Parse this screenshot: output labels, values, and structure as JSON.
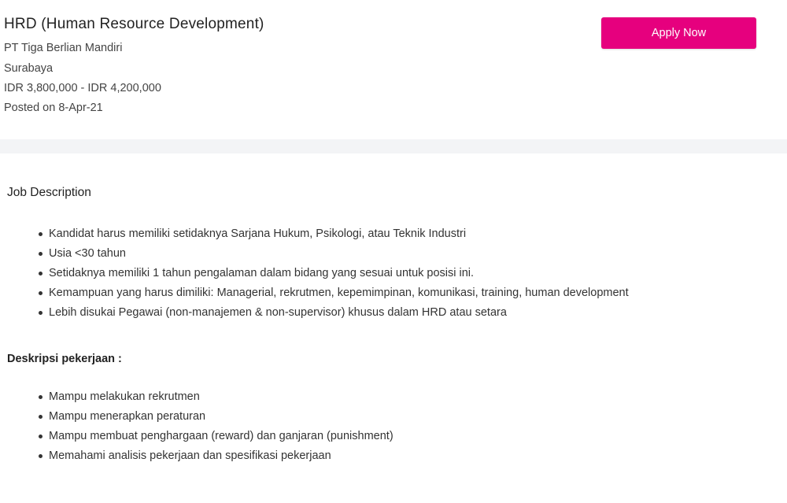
{
  "job": {
    "title": "HRD (Human Resource Development)",
    "company": "PT Tiga Berlian Mandiri",
    "location": "Surabaya",
    "salary": "IDR 3,800,000 - IDR 4,200,000",
    "posted": "Posted on 8-Apr-21"
  },
  "actions": {
    "apply_label": "Apply Now"
  },
  "description": {
    "heading": "Job Description",
    "requirements": [
      "Kandidat harus memiliki setidaknya Sarjana Hukum, Psikologi, atau Teknik Industri",
      "Usia <30 tahun",
      "Setidaknya memiliki 1 tahun pengalaman dalam bidang yang sesuai untuk posisi ini.",
      "Kemampuan yang harus dimiliki: Managerial, rekrutmen, kepemimpinan, komunikasi, training, human development",
      "Lebih disukai Pegawai (non-manajemen & non-supervisor) khusus dalam HRD atau setara"
    ],
    "duties_heading": "Deskripsi pekerjaan :",
    "duties": [
      "Mampu melakukan rekrutmen",
      "Mampu menerapkan peraturan",
      "Mampu membuat penghargaan (reward) dan ganjaran (punishment)",
      "Memahami analisis pekerjaan dan spesifikasi pekerjaan"
    ]
  },
  "colors": {
    "accent": "#e6007e",
    "divider": "#f3f4f6",
    "text": "#333333"
  }
}
